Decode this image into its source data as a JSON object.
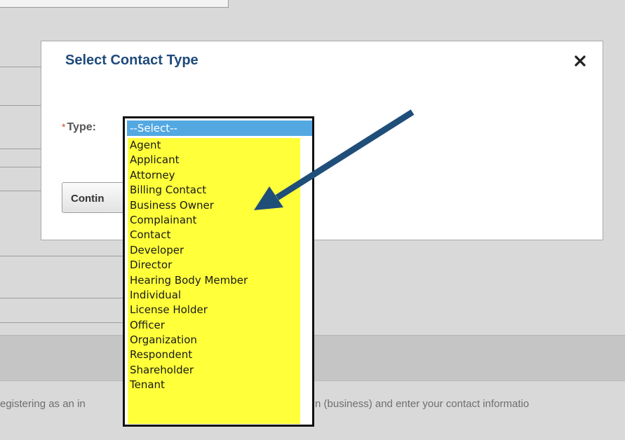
{
  "background": {
    "footer_text_left": "egistering as an in",
    "footer_text_right": "n (business) and enter your contact informatio"
  },
  "modal": {
    "title": "Select Contact Type",
    "close_glyph": "✕",
    "field_required_marker": "*",
    "field_label": "Type:",
    "continue_label": "Contin"
  },
  "dropdown": {
    "selected": "--Select--",
    "options": [
      "Agent",
      "Applicant",
      "Attorney",
      "Billing Contact",
      "Business Owner",
      "Complainant",
      "Contact",
      "Developer",
      "Director",
      "Hearing Body Member",
      "Individual",
      "License Holder",
      "Officer",
      "Organization",
      "Respondent",
      "Shareholder",
      "Tenant"
    ]
  },
  "colors": {
    "title": "#1e4a7a",
    "highlight": "#ffff3a",
    "selected": "#53a8e2",
    "arrow": "#1f4e79",
    "required": "#d04a2b"
  }
}
